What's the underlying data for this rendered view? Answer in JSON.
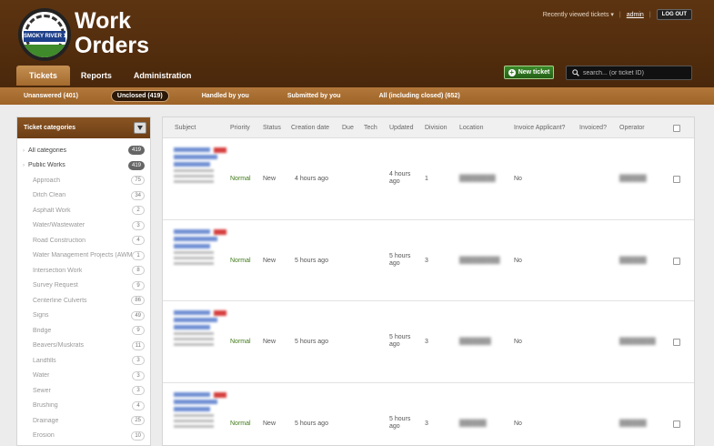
{
  "app": {
    "title_line1": "Work",
    "title_line2": "Orders",
    "logo_text": "SMOKY RIVER 130"
  },
  "top_links": {
    "recently_viewed": "Recently viewed tickets ▾",
    "user": "admin",
    "separator": "|",
    "logout": "LOG OUT"
  },
  "tabs": [
    {
      "label": "Tickets",
      "active": true
    },
    {
      "label": "Reports",
      "active": false
    },
    {
      "label": "Administration",
      "active": false
    }
  ],
  "new_ticket_label": "New ticket",
  "search": {
    "placeholder": "search... (or ticket ID)"
  },
  "subnav": [
    {
      "label": "Unanswered (401)",
      "active": false
    },
    {
      "label": "Unclosed (419)",
      "active": true
    },
    {
      "label": "Handled by you",
      "active": false
    },
    {
      "label": "Submitted by you",
      "active": false
    },
    {
      "label": "All (including closed) (652)",
      "active": false
    }
  ],
  "sidebar": {
    "heading": "Ticket categories",
    "items": [
      {
        "label": "All categories",
        "count": "419",
        "top": true
      },
      {
        "label": "Public Works",
        "count": "419",
        "top": true
      },
      {
        "label": "Approach",
        "count": "75"
      },
      {
        "label": "Ditch Clean",
        "count": "34"
      },
      {
        "label": "Asphalt Work",
        "count": "2"
      },
      {
        "label": "Water/Wastewater",
        "count": "3"
      },
      {
        "label": "Road Construction",
        "count": "4"
      },
      {
        "label": "Water Management Projects (AWMP)",
        "count": "1"
      },
      {
        "label": "Intersection Work",
        "count": "8"
      },
      {
        "label": "Survey Request",
        "count": "9"
      },
      {
        "label": "Centerline Culverts",
        "count": "86"
      },
      {
        "label": "Signs",
        "count": "49"
      },
      {
        "label": "Bridge",
        "count": "9"
      },
      {
        "label": "Beavers/Muskrats",
        "count": "11"
      },
      {
        "label": "Landfills",
        "count": "3"
      },
      {
        "label": "Water",
        "count": "3"
      },
      {
        "label": "Sewer",
        "count": "3"
      },
      {
        "label": "Brushing",
        "count": "4"
      },
      {
        "label": "Drainage",
        "count": "25"
      },
      {
        "label": "Erosion",
        "count": "10"
      }
    ]
  },
  "table": {
    "columns": {
      "subject": "Subject",
      "priority": "Priority",
      "status": "Status",
      "created": "Creation date",
      "due": "Due",
      "tech": "Tech",
      "updated": "Updated",
      "division": "Division",
      "location": "Location",
      "invoice_applicant": "Invoice Applicant?",
      "invoiced": "Invoiced?",
      "operator": "Operator"
    },
    "rows": [
      {
        "priority": "Normal",
        "status": "New",
        "created": "4 hours ago",
        "updated": "4 hours ago",
        "division": "1",
        "invoice_applicant": "No"
      },
      {
        "priority": "Normal",
        "status": "New",
        "created": "5 hours ago",
        "updated": "5 hours ago",
        "division": "3",
        "invoice_applicant": "No"
      },
      {
        "priority": "Normal",
        "status": "New",
        "created": "5 hours ago",
        "updated": "5 hours ago",
        "division": "3",
        "invoice_applicant": "No"
      },
      {
        "priority": "Normal",
        "status": "New",
        "created": "5 hours ago",
        "updated": "5 hours ago",
        "division": "3",
        "invoice_applicant": "No"
      }
    ]
  },
  "colors": {
    "header_brown": "#5d3411",
    "tab_active": "#b47d41",
    "priority_normal": "#3e7a18",
    "new_ticket_green": "#2e7a1f"
  }
}
